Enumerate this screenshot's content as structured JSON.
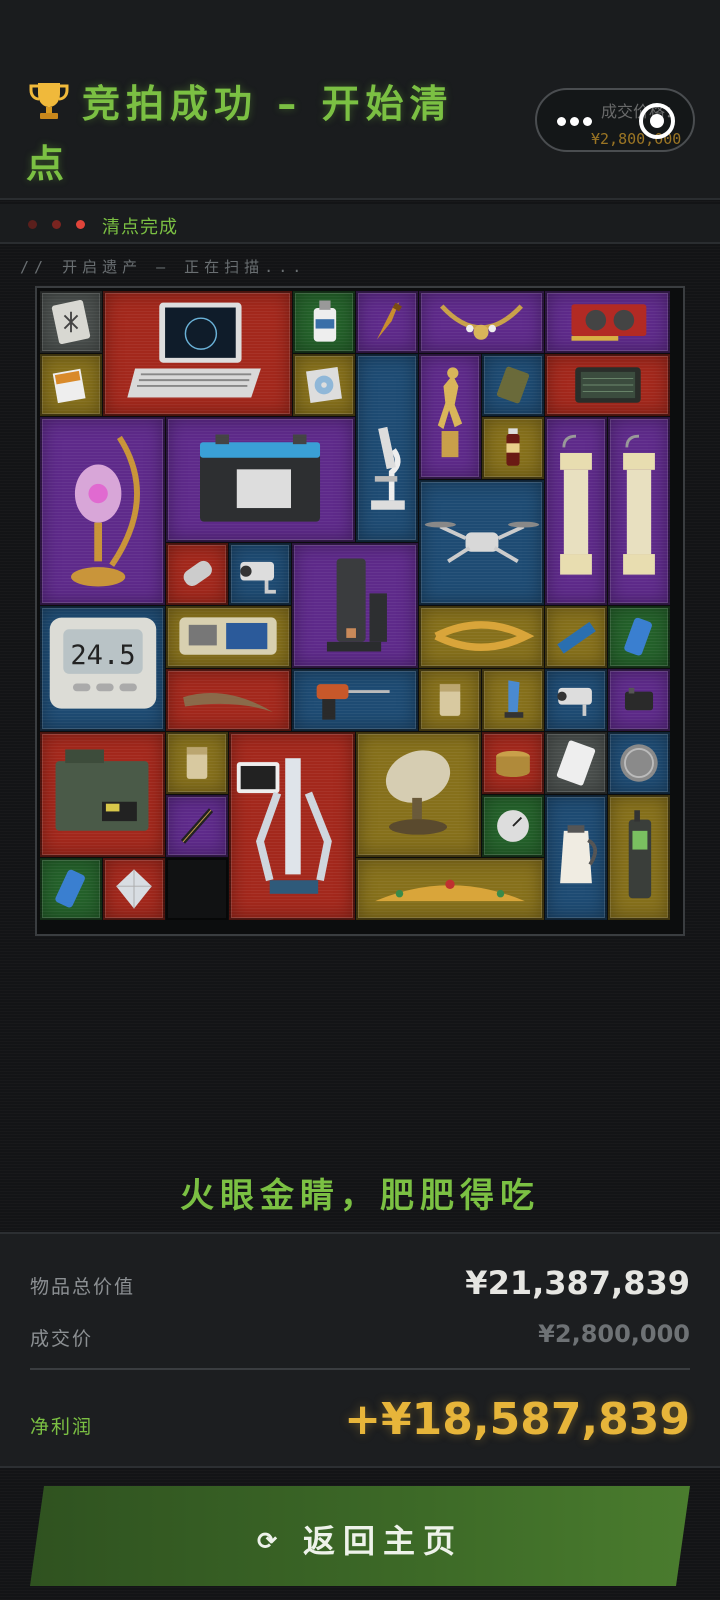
{
  "header": {
    "title": "竞拍成功 – 开始清点",
    "capsule": {
      "price_label": "成交价格：",
      "price_value": "¥2,800,000"
    }
  },
  "status": {
    "label": "清点完成",
    "scan_text": "// 开启遗产 – 正在扫描..."
  },
  "grid": {
    "items": [
      {
        "name": "item-card",
        "color": "gray"
      },
      {
        "name": "item-laptop",
        "color": "red"
      },
      {
        "name": "item-bottle",
        "color": "green"
      },
      {
        "name": "item-dagger",
        "color": "purple"
      },
      {
        "name": "item-necklace",
        "color": "purple"
      },
      {
        "name": "item-gpu",
        "color": "purple"
      },
      {
        "name": "item-cigarettes",
        "color": "gold"
      },
      {
        "name": "item-cd-case",
        "color": "gold"
      },
      {
        "name": "item-microscope",
        "color": "blue"
      },
      {
        "name": "item-statue",
        "color": "purple"
      },
      {
        "name": "item-ration",
        "color": "blue"
      },
      {
        "name": "item-tablet",
        "color": "red"
      },
      {
        "name": "item-drink",
        "color": "gold"
      },
      {
        "name": "item-moon-lamp",
        "color": "purple"
      },
      {
        "name": "item-battery",
        "color": "purple"
      },
      {
        "name": "item-lantern-1",
        "color": "purple"
      },
      {
        "name": "item-lantern-2",
        "color": "purple"
      },
      {
        "name": "item-drone",
        "color": "blue"
      },
      {
        "name": "item-canister",
        "color": "red"
      },
      {
        "name": "item-camera",
        "color": "blue"
      },
      {
        "name": "item-coffee-machine",
        "color": "purple"
      },
      {
        "name": "item-thermometer",
        "color": "blue"
      },
      {
        "name": "item-controller",
        "color": "gold"
      },
      {
        "name": "item-horn",
        "color": "red"
      },
      {
        "name": "item-drill",
        "color": "blue"
      },
      {
        "name": "item-laurel",
        "color": "gold"
      },
      {
        "name": "item-ssd",
        "color": "gold"
      },
      {
        "name": "item-can",
        "color": "green"
      },
      {
        "name": "item-lighter",
        "color": "gold"
      },
      {
        "name": "item-trophy-glass",
        "color": "gold"
      },
      {
        "name": "item-camera-2",
        "color": "blue"
      },
      {
        "name": "item-device",
        "color": "purple"
      },
      {
        "name": "item-radio",
        "color": "red"
      },
      {
        "name": "item-lighter-2",
        "color": "gold"
      },
      {
        "name": "item-robot",
        "color": "red"
      },
      {
        "name": "item-antenna",
        "color": "gold"
      },
      {
        "name": "item-caviar",
        "color": "red"
      },
      {
        "name": "item-playing-card",
        "color": "gray"
      },
      {
        "name": "item-coin",
        "color": "blue"
      },
      {
        "name": "item-pen",
        "color": "purple"
      },
      {
        "name": "item-gauge",
        "color": "green"
      },
      {
        "name": "item-kettle",
        "color": "blue"
      },
      {
        "name": "item-phone",
        "color": "gold"
      },
      {
        "name": "item-crown",
        "color": "gold"
      },
      {
        "name": "item-battery-cell",
        "color": "green"
      },
      {
        "name": "item-diamond",
        "color": "red"
      }
    ],
    "thermo_reading": "24.5"
  },
  "slogan": "火眼金睛，肥肥得吃",
  "summary": {
    "total_label": "物品总价值",
    "total_value": "¥21,387,839",
    "deal_label": "成交价",
    "deal_value": "¥2,800,000",
    "profit_label": "净利润",
    "profit_value": "+¥18,587,839"
  },
  "footer": {
    "home_button": "返回主页",
    "home_icon": "refresh-icon"
  },
  "colors": {
    "accent_green": "#7bc043",
    "gold": "#e7b53a",
    "rarity": {
      "gray": "#4a4f4d",
      "red": "#a3281c",
      "green": "#24612a",
      "purple": "#5e2a8a",
      "blue": "#1e4b73",
      "gold": "#86701b"
    }
  }
}
